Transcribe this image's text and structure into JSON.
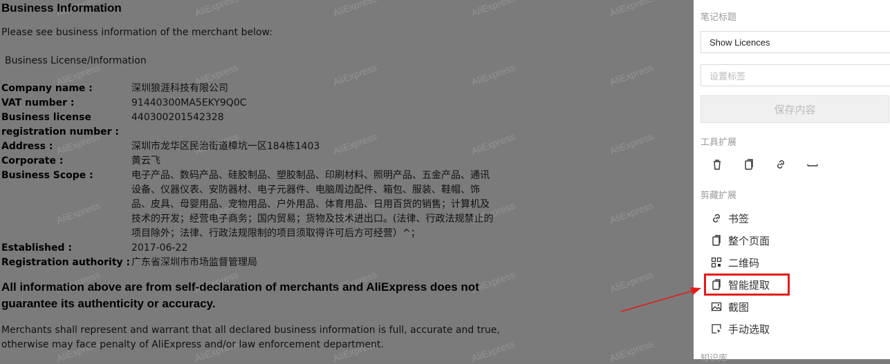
{
  "watermark": "AliExpress",
  "page": {
    "title": "Business Information",
    "intro": "Please see business information of the merchant below:",
    "subhead": "Business License/Information",
    "rows": [
      {
        "k": "Company name :",
        "v": "深圳狼涯科技有限公司"
      },
      {
        "k": "VAT number :",
        "v": "91440300MA5EKY9Q0C"
      },
      {
        "k": "Business license registration number :",
        "v": "440300201542328"
      },
      {
        "k": "Address :",
        "v": "深圳市龙华区民治街道樟坑一区184栋1403"
      },
      {
        "k": "Corporate :",
        "v": "黄云飞"
      },
      {
        "k": "Business Scope :",
        "v": "电子产品、数码产品、硅胶制品、塑胶制品、印刷材料、照明产品、五金产品、通讯设备、仪器仪表、安防器材、电子元器件、电脑周边配件、箱包、服装、鞋帽、饰品、皮具、母婴用品、宠物用品、户外用品、体育用品、日用百货的销售；计算机及技术的开发；经营电子商务；国内贸易；货物及技术进出口。(法律、行政法规禁止的项目除外；法律、行政法规限制的项目须取得许可后方可经营）^；"
      },
      {
        "k": "Established :",
        "v": "2017-06-22"
      },
      {
        "k": "Registration authority :",
        "v": "广东省深圳市市场监督管理局"
      }
    ],
    "disclaimer": "All information above are from self-declaration of merchants and AliExpress does not guarantee its authenticity or accuracy.",
    "note": "Merchants shall represent and warrant that all declared business information is full, accurate and true, otherwise may face penalty of AliExpress and/or law enforcement department."
  },
  "panel": {
    "note_title_label": "笔记标题",
    "note_title_value": "Show Licences",
    "tag_placeholder": "设置标签",
    "save_label": "保存内容",
    "tools_label": "工具扩展",
    "tools": [
      {
        "icon": "trash-icon"
      },
      {
        "icon": "copy-icon"
      },
      {
        "icon": "link-icon"
      },
      {
        "icon": "minus-icon"
      }
    ],
    "clip_label": "剪藏扩展",
    "clip_items": [
      {
        "label": "书签",
        "icon": "link-icon"
      },
      {
        "label": "整个页面",
        "icon": "page-icon"
      },
      {
        "label": "二维码",
        "icon": "qrcode-icon"
      },
      {
        "label": "智能提取",
        "icon": "page-icon"
      },
      {
        "label": "截图",
        "icon": "image-icon"
      },
      {
        "label": "手动选取",
        "icon": "select-icon"
      }
    ],
    "kb_label": "知识库"
  },
  "colors": {
    "highlight": "#e21b1b",
    "overlay": "#7b7b7b"
  }
}
